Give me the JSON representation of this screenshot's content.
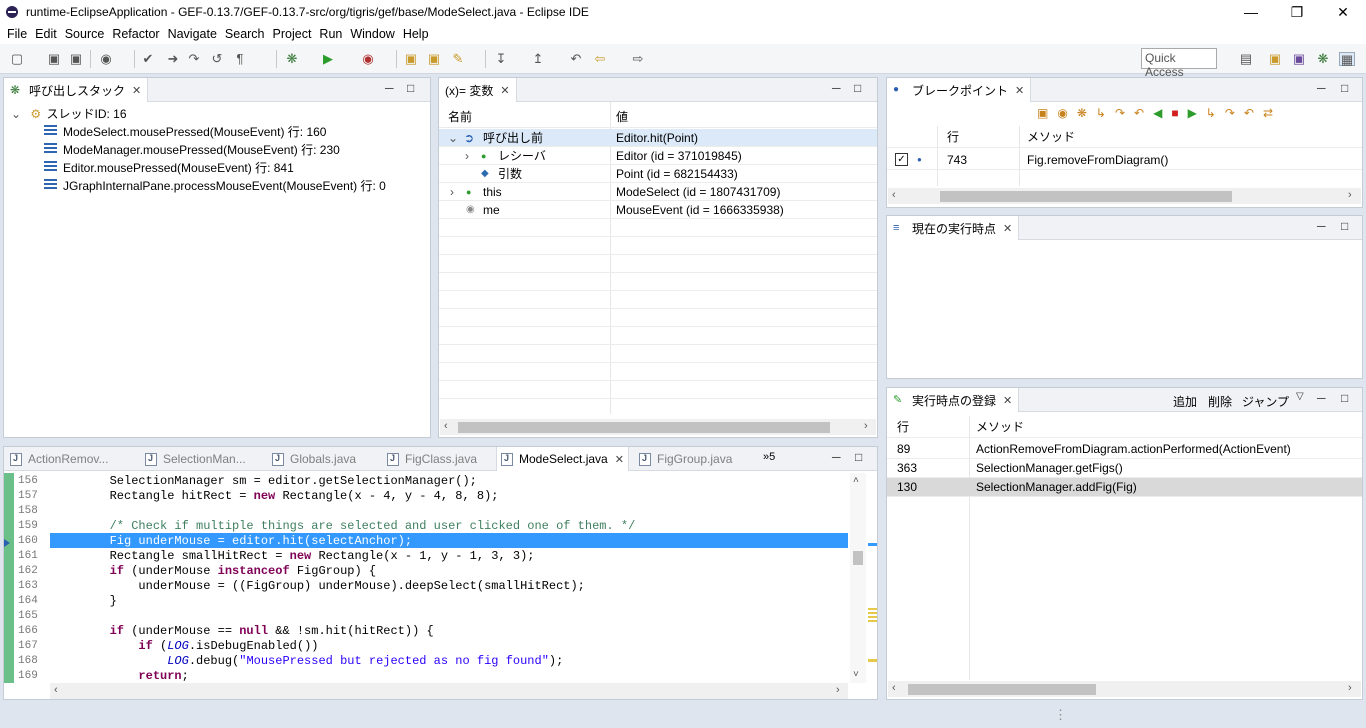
{
  "window": {
    "title": "runtime-EclipseApplication - GEF-0.13.7/GEF-0.13.7-src/org/tigris/gef/base/ModeSelect.java - Eclipse IDE"
  },
  "menu": [
    "File",
    "Edit",
    "Source",
    "Refactor",
    "Navigate",
    "Search",
    "Project",
    "Run",
    "Window",
    "Help"
  ],
  "toolbar": {
    "quick_access": "Quick Access"
  },
  "callstack": {
    "tab": "呼び出しスタック",
    "thread": "スレッドID: 16",
    "frames": [
      "ModeSelect.mousePressed(MouseEvent) 行: 160",
      "ModeManager.mousePressed(MouseEvent) 行: 230",
      "Editor.mousePressed(MouseEvent) 行: 841",
      "JGraphInternalPane.processMouseEvent(MouseEvent) 行: 0"
    ]
  },
  "variables": {
    "tab": "(x)= 変数",
    "col_name": "名前",
    "col_value": "値",
    "rows": [
      {
        "name": "呼び出し前",
        "value": "Editor.hit(Point)"
      },
      {
        "name": "レシーバ",
        "value": "Editor (id = 371019845)"
      },
      {
        "name": "引数",
        "value": "Point (id = 682154433)"
      },
      {
        "name": "this",
        "value": "ModeSelect (id = 1807431709)"
      },
      {
        "name": "me",
        "value": "MouseEvent (id = 1666335938)"
      }
    ]
  },
  "breakpoints": {
    "tab": "ブレークポイント",
    "col_line": "行",
    "col_method": "メソッド",
    "rows": [
      {
        "line": "743",
        "method": "Fig.removeFromDiagram()"
      }
    ]
  },
  "current": {
    "tab": "現在の実行時点"
  },
  "registered": {
    "tab": "実行時点の登録",
    "add": "追加",
    "remove": "削除",
    "jump": "ジャンプ",
    "col_line": "行",
    "col_method": "メソッド",
    "rows": [
      {
        "line": "89",
        "method": "ActionRemoveFromDiagram.actionPerformed(ActionEvent)"
      },
      {
        "line": "363",
        "method": "SelectionManager.getFigs()"
      },
      {
        "line": "130",
        "method": "SelectionManager.addFig(Fig)"
      }
    ]
  },
  "editor": {
    "tabs": [
      "ActionRemov...",
      "SelectionMan...",
      "Globals.java",
      "FigClass.java",
      "ModeSelect.java",
      "FigGroup.java"
    ],
    "overflow": "»5",
    "lines": [
      "156",
      "157",
      "158",
      "159",
      "160",
      "161",
      "162",
      "163",
      "164",
      "165",
      "166",
      "167",
      "168",
      "169"
    ]
  },
  "colors": {
    "accent": "#3399ff",
    "selection": "#3399ff",
    "keyword": "#7f0055",
    "comment": "#3f7f5f",
    "string": "#2a00ff"
  }
}
